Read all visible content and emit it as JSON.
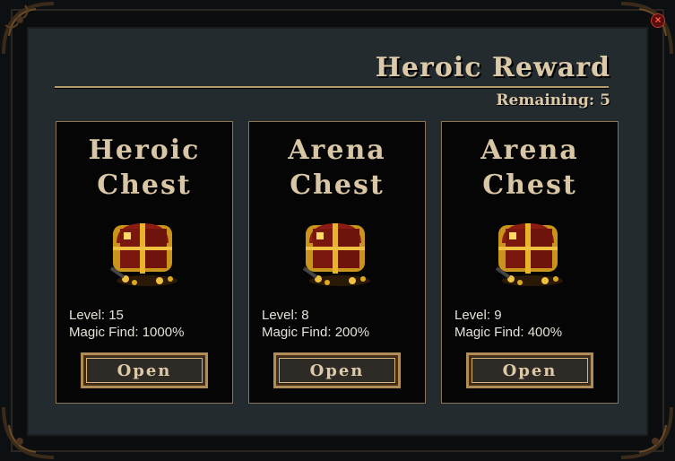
{
  "window": {
    "title": "Heroic Reward",
    "remaining_label": "Remaining:",
    "remaining_count": "5",
    "close_icon": "close-icon"
  },
  "colors": {
    "panel_bg": "#232b2f",
    "card_bg": "#050505",
    "title_text": "#dcc9a8",
    "button_gold": "#b08d57"
  },
  "cards": [
    {
      "title_line1": "Heroic",
      "title_line2": "Chest",
      "icon": "treasure-chest-icon",
      "level": "Level: 15",
      "magic_find": "Magic Find: 1000%",
      "button": "Open"
    },
    {
      "title_line1": "Arena",
      "title_line2": "Chest",
      "icon": "treasure-chest-icon",
      "level": "Level: 8",
      "magic_find": "Magic Find: 200%",
      "button": "Open"
    },
    {
      "title_line1": "Arena",
      "title_line2": "Chest",
      "icon": "treasure-chest-icon",
      "level": "Level: 9",
      "magic_find": "Magic Find: 400%",
      "button": "Open"
    }
  ]
}
